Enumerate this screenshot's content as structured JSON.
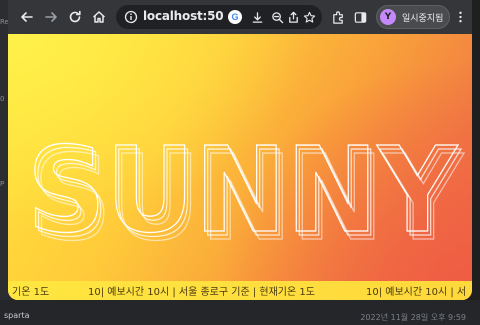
{
  "browser": {
    "url": "localhost:50",
    "profile_initial": "Y",
    "profile_label": "일시중지됨"
  },
  "page": {
    "hero_title": "SUNNY",
    "ticker_items": [
      "기온 1도",
      "10| 예보시간 10시 | 서울 종로구 기준 | 현재기온 1도",
      "10| 예보시간 10시 | 서"
    ]
  },
  "background": {
    "left_labels": [
      "Res",
      "0",
      "P"
    ],
    "bottom_left": "sparta",
    "bottom_right": "2022년 11월 28일 오후 9:59"
  },
  "icons": {
    "back": "back-arrow-icon",
    "forward": "forward-arrow-icon",
    "reload": "reload-icon",
    "home": "home-icon",
    "info": "info-icon",
    "google": "google-icon",
    "download": "download-icon",
    "zoom": "zoom-icon",
    "share": "share-icon",
    "bookmark": "star-icon",
    "extensions": "puzzle-icon",
    "sidebar": "sidebar-icon",
    "menu": "kebab-menu-icon"
  },
  "colors": {
    "gradient_start": "#ffe43c",
    "gradient_end": "#ee6a45",
    "ticker_bg": "#ffe641",
    "toolbar": "#35363a"
  }
}
